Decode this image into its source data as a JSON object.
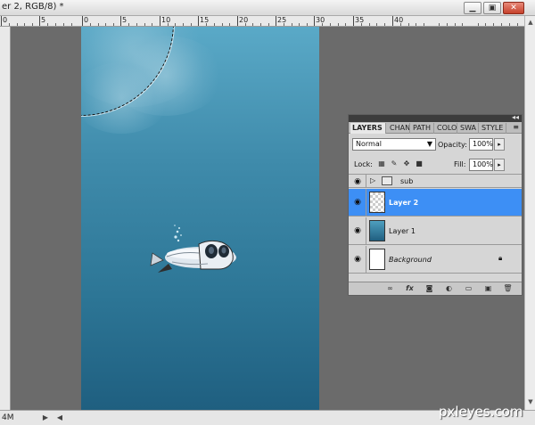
{
  "window": {
    "title": "er 2, RGB/8) *"
  },
  "window_buttons": {
    "minimize": "▁",
    "restore": "▣",
    "close": "✕"
  },
  "rulers": {
    "top_labels": [
      "0",
      "5",
      "0",
      "5",
      "10",
      "15",
      "20",
      "25",
      "30",
      "35",
      "40"
    ]
  },
  "status": {
    "zoom": "4M"
  },
  "panel": {
    "tabs": [
      "LAYERS",
      "CHAN",
      "PATH",
      "COLO",
      "SWA",
      "STYLE"
    ],
    "menu_icon": "≡",
    "collapse_icon": "◂◂",
    "blend_mode": "Normal",
    "opacity_label": "Opacity:",
    "opacity_value": "100%",
    "lock_label": "Lock:",
    "fill_label": "Fill:",
    "fill_value": "100%",
    "layers": [
      {
        "name": "sub",
        "type": "group"
      },
      {
        "name": "Layer 2",
        "type": "layer",
        "active": true
      },
      {
        "name": "Layer 1",
        "type": "layer"
      },
      {
        "name": "Background",
        "type": "background"
      }
    ],
    "footer_icons": [
      "link-icon",
      "fx-icon",
      "mask-icon",
      "adjustment-icon",
      "group-icon",
      "new-layer-icon",
      "trash-icon"
    ]
  },
  "watermark": "pxleyes.com"
}
